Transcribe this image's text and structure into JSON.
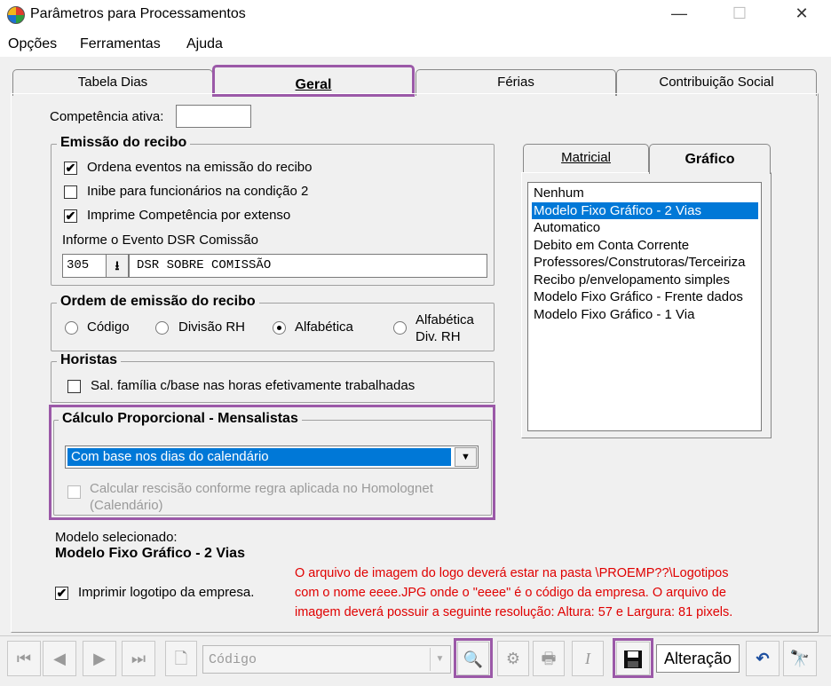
{
  "window": {
    "title": "Parâmetros para Processamentos",
    "minimize": "—",
    "maximize": "☐",
    "close": "✕"
  },
  "menu": [
    "Opções",
    "Ferramentas",
    "Ajuda"
  ],
  "tabs": [
    "Tabela Dias",
    "Geral",
    "Férias",
    "Contribuição Social"
  ],
  "competencia": {
    "label": "Competência ativa:",
    "value": ""
  },
  "emissao": {
    "title": "Emissão do recibo",
    "ordena": "Ordena eventos na emissão do recibo",
    "inibe": "Inibe para funcionários na condição 2",
    "imprime": "Imprime Competência por extenso",
    "dsr_label": "Informe o Evento DSR Comissão",
    "dsr_code": "305",
    "dsr_desc": "DSR SOBRE COMISSÃO"
  },
  "ordem": {
    "title": "Ordem de emissão do recibo",
    "opt_codigo": "Código",
    "opt_divisao": "Divisão RH",
    "opt_alfabetica": "Alfabética",
    "opt_alfdiv_1": "Alfabética",
    "opt_alfdiv_2": "Div.  RH",
    "selected": "Alfabética"
  },
  "horistas": {
    "title": "Horistas",
    "salfamilia": "Sal. família c/base nas horas efetivamente trabalhadas"
  },
  "calculo": {
    "title": "Cálculo Proporcional - Mensalistas",
    "select_value": "Com base nos dias do calendário",
    "rescisao_1": "Calcular rescisão conforme regra aplicada no Homolognet",
    "rescisao_2": "(Calendário)"
  },
  "modelo": {
    "label": "Modelo selecionado:",
    "value": "Modelo Fixo Gráfico - 2 Vias"
  },
  "imprimir_logo": "Imprimir logotipo da empresa.",
  "info": [
    "O arquivo de imagem do logo deverá estar na pasta \\PROEMP??\\Logotipos",
    "com o nome eeee.JPG onde o \"eeee\" é o código da empresa. O arquivo de",
    "imagem deverá possuir a seguinte resolução: Altura: 57 e Largura: 81 pixels."
  ],
  "subtabs": [
    "Matricial",
    "Gráfico"
  ],
  "modelos": [
    "Nenhum",
    "Modelo Fixo Gráfico - 2 Vias",
    "Automatico",
    "Debito em Conta Corrente",
    "Professores/Construtoras/Terceiriza",
    "Recibo p/envelopamento simples",
    "Modelo Fixo Gráfico - Frente dados",
    "Modelo Fixo Gráfico - 1 Via"
  ],
  "modelo_selected_index": 1,
  "toolbar": {
    "search_field": "Código",
    "status": "Alteração"
  },
  "colors": {
    "highlight": "#9b59a8",
    "selection": "#0078d7",
    "info_red": "#e00000"
  }
}
